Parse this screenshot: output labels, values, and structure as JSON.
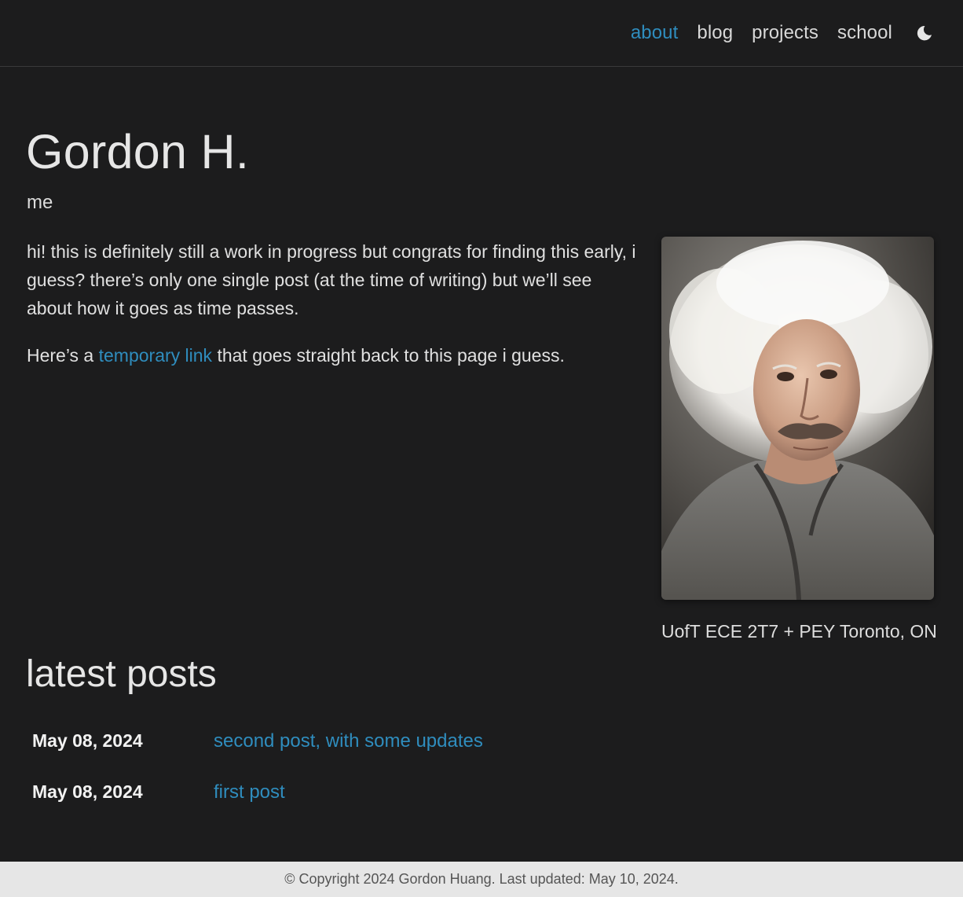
{
  "nav": {
    "items": [
      {
        "label": "about",
        "active": true
      },
      {
        "label": "blog",
        "active": false
      },
      {
        "label": "projects",
        "active": false
      },
      {
        "label": "school",
        "active": false
      }
    ],
    "theme_icon": "moon-icon"
  },
  "header": {
    "title": "Gordon H.",
    "subtitle": "me"
  },
  "intro": {
    "paragraph1": "hi! this is definitely still a work in progress but congrats for finding this early, i guess? there’s only one single post (at the time of writing) but we’ll see about how it goes as time passes.",
    "paragraph2_before": "Here’s a ",
    "paragraph2_link": "temporary link",
    "paragraph2_after": " that goes straight back to this page i guess."
  },
  "profile": {
    "caption": "UofT ECE 2T7 + PEY Toronto, ON"
  },
  "latest_posts": {
    "title": "latest posts",
    "posts": [
      {
        "date": "May 08, 2024",
        "title": "second post, with some updates"
      },
      {
        "date": "May 08, 2024",
        "title": "first post"
      }
    ]
  },
  "footer": {
    "text": "© Copyright 2024 Gordon Huang. Last updated: May 10, 2024."
  },
  "colors": {
    "background": "#1c1c1d",
    "accent": "#2f8dbe",
    "footer_bg": "#e6e6e6"
  }
}
